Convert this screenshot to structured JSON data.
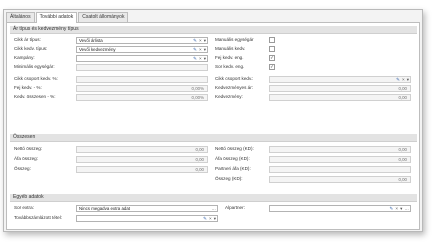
{
  "tabs": [
    "Általános",
    "További adatok",
    "Csatolt állományok"
  ],
  "sections": {
    "price": "Ár típus és kedvezmény típus",
    "totals": "Összesen",
    "other": "Egyéb adatok"
  },
  "price": {
    "ar_tipus": {
      "label": "Cikk ár típus:",
      "value": "Vevői árlista"
    },
    "kedv_tipus": {
      "label": "Cikk kedv. típus:",
      "value": "Vevői kedvezmény"
    },
    "kampany": {
      "label": "Kampány:",
      "value": ""
    },
    "min_egyseg": {
      "label": "Minimális egységár:",
      "value": ""
    },
    "csoport_kedv": {
      "label": "Cikk csoport kedv. %:",
      "value": ""
    },
    "fej_kedv": {
      "label": "Fej kedv. - %:",
      "value": "0,00%"
    },
    "kedv_osszesen": {
      "label": "Kedv. összesen - %:",
      "value": "0,00%"
    },
    "manualis_egysegar": {
      "label": "Manuális egységár",
      "checked": false
    },
    "manualis_kedv": {
      "label": "Manuális kedv.",
      "checked": false
    },
    "fej_kedv_eng": {
      "label": "Fej kedv. eng.",
      "checked": true
    },
    "sor_kedv_eng": {
      "label": "Sor kedv. eng.",
      "checked": true
    },
    "cikk_csoport_kedv": {
      "label": "Cikk csoport kedv.:",
      "value": ""
    },
    "kedvezmenyes_ar": {
      "label": "Kedvezményes ár:",
      "value": "0,00"
    },
    "kedvezmeny": {
      "label": "Kedvezmény:",
      "value": "0,00"
    }
  },
  "totals": {
    "netto": {
      "label": "Nettó összeg:",
      "value": "0,00"
    },
    "afa": {
      "label": "Áfa összeg:",
      "value": "0,00"
    },
    "osszeg": {
      "label": "Összeg:",
      "value": "0,00"
    },
    "netto_kd": {
      "label": "Nettó összeg (KD):",
      "value": "0,00"
    },
    "afa_kd": {
      "label": "Áfa összeg (KD):",
      "value": "0,00"
    },
    "partneri_afa_kd": {
      "label": "Partneri áfa (KD):",
      "value": ""
    },
    "osszeg_kd": {
      "label": "Összeg (KD):",
      "value": "0,00"
    }
  },
  "other": {
    "sor_extra": {
      "label": "Sor extra:",
      "value": "Nincs megadva extra adat"
    },
    "tovabbszamlazott": {
      "label": "Továbbszámlázott tétel:",
      "value": ""
    },
    "alpartner": {
      "label": "Alpartner:",
      "value": ""
    }
  },
  "icons": {
    "pencil": "pencil-icon",
    "clear": "clear-icon",
    "dropdown": "chevron-down-icon",
    "ellipsis": "ellipsis-icon"
  },
  "colors": {
    "section_bg": "#e3e3e3",
    "accent": "#2f5fa8"
  }
}
